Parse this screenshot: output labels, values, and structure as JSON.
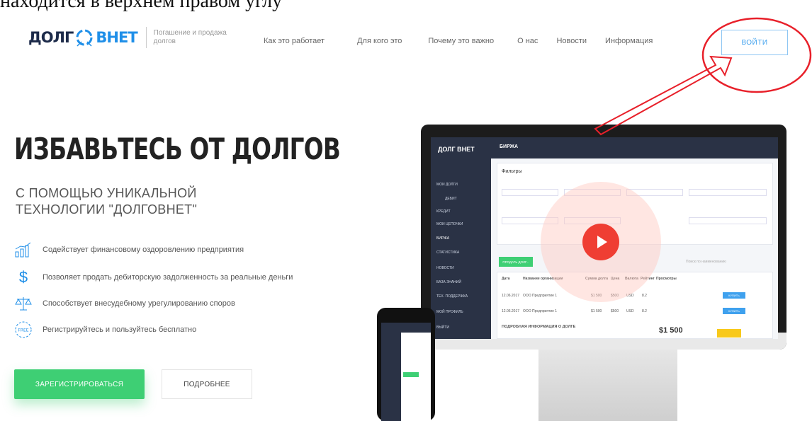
{
  "caption": "находится в верхнем правом углу",
  "logo": {
    "part1": "ДОЛГ",
    "part2": "ВНЕТ",
    "tagline": "Погашение и продажа долгов"
  },
  "nav": [
    {
      "label": "Как это работает"
    },
    {
      "label": "Для кого это"
    },
    {
      "label": "Почему это важно"
    },
    {
      "label": "О нас"
    },
    {
      "label": "Новости"
    },
    {
      "label": "Информация"
    }
  ],
  "login_label": "ВОЙТИ",
  "hero": {
    "title": "ИЗБАВЬТЕСЬ ОТ ДОЛГОВ",
    "subtitle_line1": "С ПОМОЩЬЮ УНИКАЛЬНОЙ",
    "subtitle_line2": "ТЕХНОЛОГИИ \"ДОЛГОВНЕТ\""
  },
  "features": [
    {
      "icon": "chart-growth-icon",
      "text": "Содействует финансовому оздоровлению предприятия"
    },
    {
      "icon": "dollar-icon",
      "text": "Позволяет продать дебиторскую задолженность за реальные деньги"
    },
    {
      "icon": "scales-icon",
      "text": "Способствует внесудебному урегулированию споров"
    },
    {
      "icon": "free-badge-icon",
      "text": "Регистрируйтесь и пользуйтесь бесплатно"
    }
  ],
  "buttons": {
    "register": "ЗАРЕГИСТРИРОВАТЬСЯ",
    "more": "ПОДРОБНЕЕ"
  },
  "app": {
    "brand": "ДОЛГ ВНЕТ",
    "section": "БИРЖА",
    "filters_title": "Фильтры",
    "sidebar": [
      "МОИ ДОЛГИ",
      "ДЕБИТ",
      "КРЕДИТ",
      "МОИ ЦЕПОЧКИ",
      "БИРЖА",
      "СТАТИСТИКА",
      "НОВОСТИ",
      "БАЗА ЗНАНИЙ",
      "ТЕХ. ПОДДЕРЖКА",
      "МОЙ ПРОФИЛЬ",
      "ВЫЙТИ"
    ],
    "sell_button": "ПРОДАТЬ ДОЛГ...",
    "search_placeholder": "Поиск по наименованию",
    "table_headers": [
      "Дата",
      "Название организации",
      "Сумма долга",
      "Цена",
      "Валюта",
      "Рейтинг",
      "Просмотры"
    ],
    "rows": [
      {
        "date": "12.06.2017",
        "org": "ООО Предприятие 1",
        "sum": "$1 500",
        "price": "$500",
        "cur": "USD",
        "rating": "8.2"
      },
      {
        "date": "12.06.2017",
        "org": "ООО Предприятие 1",
        "sum": "$1 500",
        "price": "$500",
        "cur": "USD",
        "rating": "8.2"
      }
    ],
    "detail_title": "ПОДРОБНАЯ ИНФОРМАЦИЯ О ДОЛГЕ",
    "detail_amount": "$1 500",
    "buy_label": "КУПИТЬ"
  },
  "colors": {
    "accent": "#1f8fe8",
    "green": "#3ecf74",
    "red": "#ef3e33",
    "annotation": "#e8202a"
  }
}
